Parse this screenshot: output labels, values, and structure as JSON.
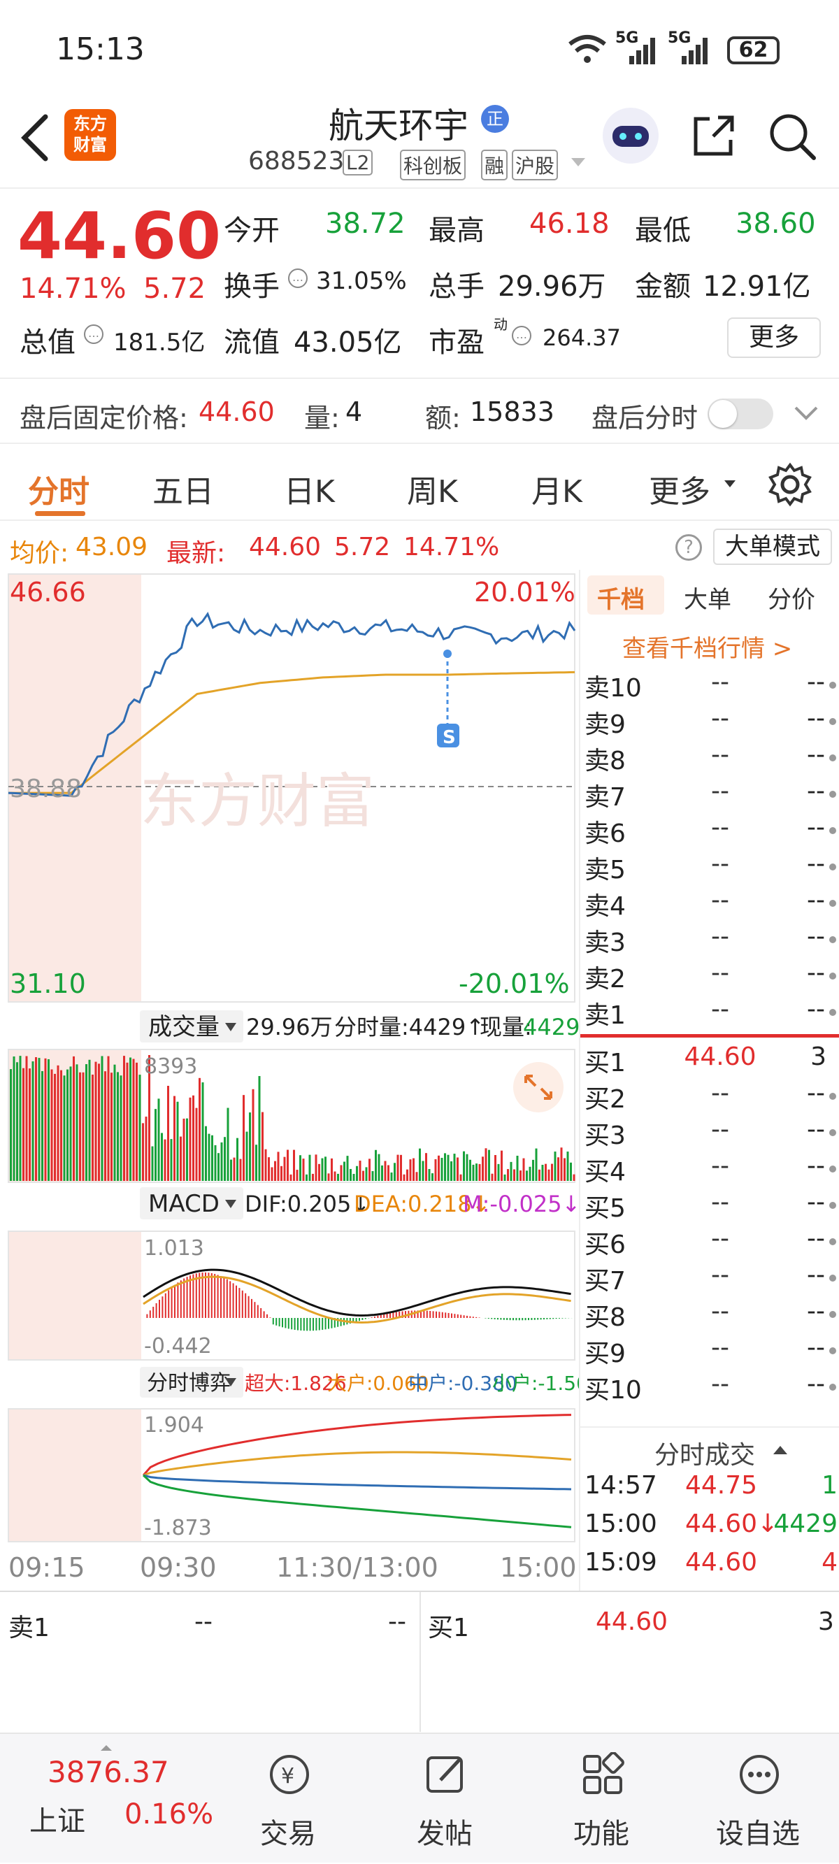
{
  "status_bar": {
    "time": "15:13",
    "net1": "5G",
    "net2": "5G",
    "battery": "62"
  },
  "header": {
    "logo_line1": "东方",
    "logo_line2": "财富",
    "stock_name": "航天环宇",
    "name_badge": "正",
    "code": "688523",
    "level": "L2",
    "tags": [
      "科创板",
      "融",
      "沪股"
    ]
  },
  "quote": {
    "price": "44.60",
    "change_pct": "14.71%",
    "change": "5.72",
    "open_label": "今开",
    "open": "38.72",
    "high_label": "最高",
    "high": "46.18",
    "low_label": "最低",
    "low": "38.60",
    "turnover_label": "换手",
    "turnover": "31.05%",
    "volume_label": "总手",
    "volume": "29.96万",
    "amount_label": "金额",
    "amount": "12.91亿",
    "mcap_label": "总值",
    "mcap": "181.5亿",
    "float_label": "流值",
    "float_cap": "43.05亿",
    "pe_label": "市盈",
    "pe_sup": "动",
    "pe": "264.37",
    "more_button": "更多"
  },
  "after_hours": {
    "price_label": "盘后固定价格:",
    "price": "44.60",
    "vol_label": "量:",
    "vol": "4",
    "amount_label": "额:",
    "amount": "15833",
    "timeshare_label": "盘后分时"
  },
  "tabs": [
    "分时",
    "五日",
    "日K",
    "周K",
    "月K",
    "更多"
  ],
  "avg_bar": {
    "avg_label": "均价:",
    "avg": "43.09",
    "latest_label": "最新:",
    "latest": "44.60",
    "change": "5.72",
    "change_pct": "14.71%",
    "mode_button": "大单模式"
  },
  "price_chart": {
    "top_price": "46.66",
    "top_pct": "20.01%",
    "bottom_price": "31.10",
    "bottom_pct": "-20.01%",
    "ref_price": "38.88",
    "marker": "S",
    "watermark": "东方财富"
  },
  "volume_panel": {
    "label": "成交量",
    "total": "29.96万",
    "period_vol": "分时量:4429↑",
    "cur_label": "现量:",
    "cur": "4429",
    "max": "8393"
  },
  "macd_panel": {
    "label": "MACD",
    "dif": "DIF:0.205↓",
    "dea": "DEA:0.218↓",
    "m": "M:-0.025↓",
    "max": "1.013",
    "min": "-0.442"
  },
  "flow_panel": {
    "label": "分时博弈",
    "super": "超大:1.826",
    "large": "大户:0.060",
    "mid": "中户:-0.380",
    "small": "小户:-1.506",
    "max": "1.904",
    "min": "-1.873"
  },
  "time_axis": [
    "09:15",
    "09:30",
    "11:30/13:00",
    "15:00"
  ],
  "orderbook": {
    "tabs": [
      "千档",
      "大单",
      "分价"
    ],
    "link": "查看千档行情 >",
    "asks": [
      {
        "n": "卖10",
        "p": "--",
        "v": "--"
      },
      {
        "n": "卖9",
        "p": "--",
        "v": "--"
      },
      {
        "n": "卖8",
        "p": "--",
        "v": "--"
      },
      {
        "n": "卖7",
        "p": "--",
        "v": "--"
      },
      {
        "n": "卖6",
        "p": "--",
        "v": "--"
      },
      {
        "n": "卖5",
        "p": "--",
        "v": "--"
      },
      {
        "n": "卖4",
        "p": "--",
        "v": "--"
      },
      {
        "n": "卖3",
        "p": "--",
        "v": "--"
      },
      {
        "n": "卖2",
        "p": "--",
        "v": "--"
      },
      {
        "n": "卖1",
        "p": "--",
        "v": "--"
      }
    ],
    "bids": [
      {
        "n": "买1",
        "p": "44.60",
        "v": "3"
      },
      {
        "n": "买2",
        "p": "--",
        "v": "--"
      },
      {
        "n": "买3",
        "p": "--",
        "v": "--"
      },
      {
        "n": "买4",
        "p": "--",
        "v": "--"
      },
      {
        "n": "买5",
        "p": "--",
        "v": "--"
      },
      {
        "n": "买6",
        "p": "--",
        "v": "--"
      },
      {
        "n": "买7",
        "p": "--",
        "v": "--"
      },
      {
        "n": "买8",
        "p": "--",
        "v": "--"
      },
      {
        "n": "买9",
        "p": "--",
        "v": "--"
      },
      {
        "n": "买10",
        "p": "--",
        "v": "--"
      }
    ],
    "trades_title": "分时成交",
    "trades": [
      {
        "t": "14:57",
        "p": "44.75",
        "v": "1"
      },
      {
        "t": "15:00",
        "p": "44.60↓",
        "v": "4429"
      },
      {
        "t": "15:09",
        "p": "44.60",
        "v": "4"
      }
    ]
  },
  "bottom_row": {
    "ask_label": "卖1",
    "ask_price": "--",
    "ask_vol": "--",
    "bid_label": "买1",
    "bid_price": "44.60",
    "bid_vol": "3"
  },
  "bottom_nav": {
    "index_value": "3876.37",
    "index_name": "上证",
    "index_pct": "0.16%",
    "items": [
      "交易",
      "发帖",
      "功能",
      "设自选"
    ]
  },
  "chart_data": {
    "type": "line",
    "x": [
      "09:15",
      "09:30",
      "10:00",
      "10:30",
      "11:00",
      "11:30/13:00",
      "13:30",
      "14:00",
      "14:30",
      "15:00"
    ],
    "series": [
      {
        "values": [
          38.7,
          38.6,
          42.0,
          45.0,
          44.6,
          44.8,
          44.7,
          44.5,
          44.4,
          44.6
        ]
      },
      {
        "values": [
          38.7,
          38.7,
          40.5,
          42.3,
          42.7,
          42.9,
          43.0,
          43.0,
          43.05,
          43.09
        ]
      }
    ],
    "ylim": [
      31.1,
      46.66
    ],
    "grid": true
  }
}
